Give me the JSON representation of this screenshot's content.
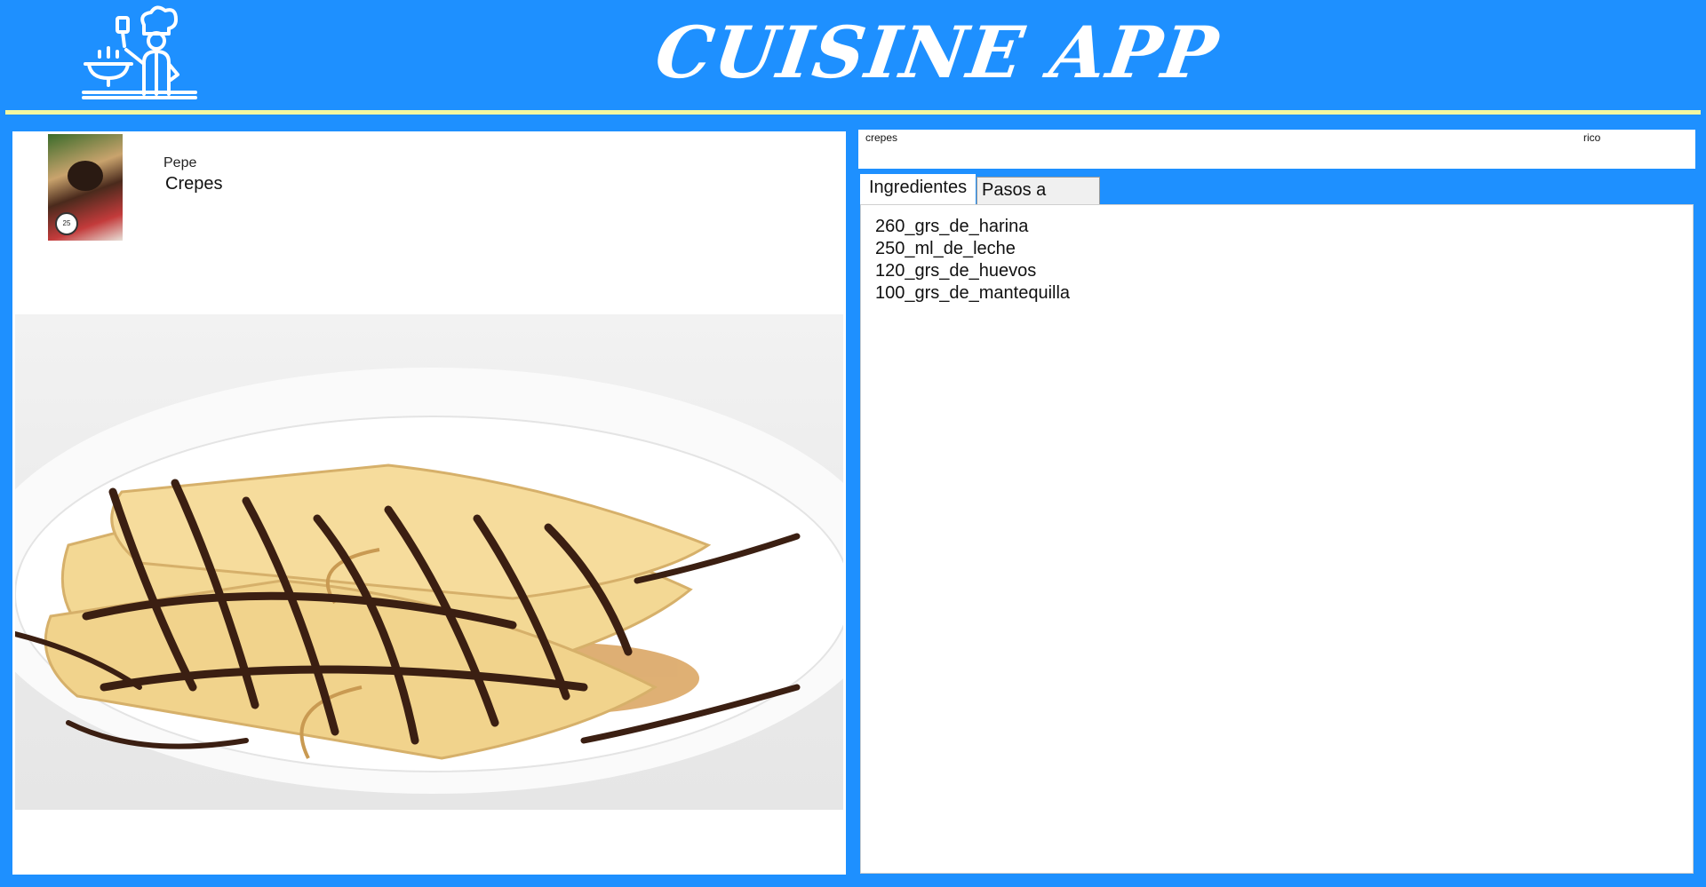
{
  "header": {
    "title": "CUISINE APP",
    "logo_icon": "chef-cooking-icon",
    "colors": {
      "background": "#1e90ff",
      "divider": "#f3f7a0",
      "title": "#ffffff"
    }
  },
  "recipe": {
    "author": "Pepe",
    "name": "Crepes",
    "avatar_tag": "25",
    "dish_image": "crepes-with-chocolate-photo"
  },
  "search": {
    "term": "crepes",
    "tag": "rico"
  },
  "tabs": [
    {
      "label": "Ingredientes",
      "active": true
    },
    {
      "label": "Pasos a seguir",
      "active": false
    }
  ],
  "ingredients": [
    "260_grs_de_harina",
    "250_ml_de_leche",
    "120_grs_de_huevos",
    "100_grs_de_mantequilla"
  ]
}
